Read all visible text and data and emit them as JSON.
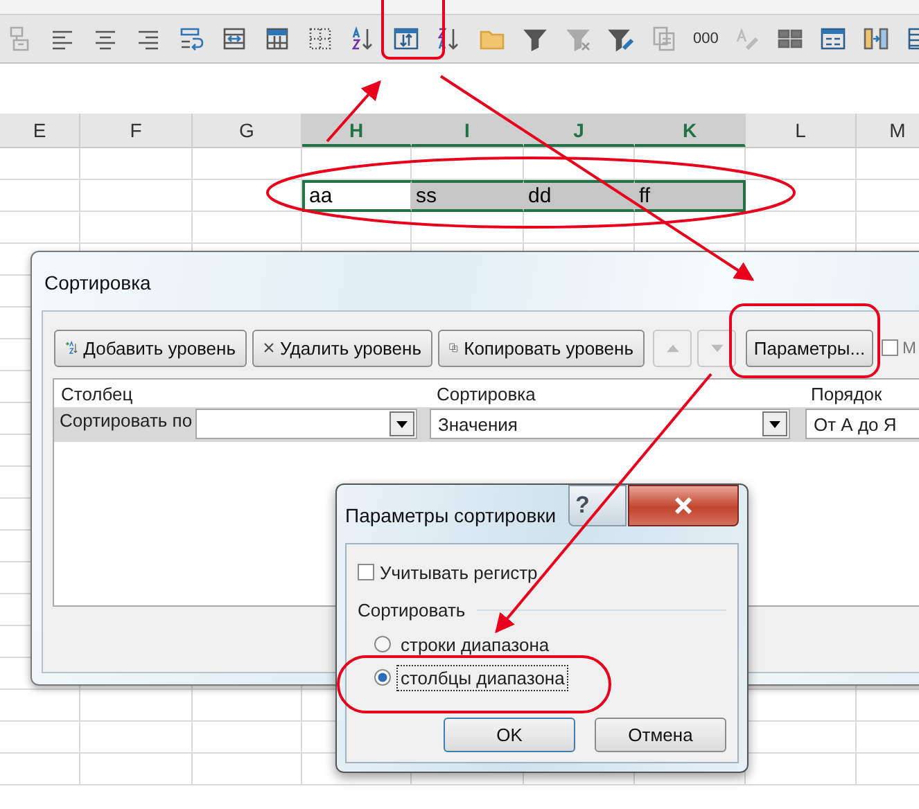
{
  "toolbar": {
    "number_format_label": "000"
  },
  "columns": [
    {
      "label": "E",
      "selected": false
    },
    {
      "label": "F",
      "selected": false
    },
    {
      "label": "G",
      "selected": false
    },
    {
      "label": "H",
      "selected": true
    },
    {
      "label": "I",
      "selected": true
    },
    {
      "label": "J",
      "selected": true
    },
    {
      "label": "K",
      "selected": true
    },
    {
      "label": "L",
      "selected": false
    },
    {
      "label": "M",
      "selected": false
    }
  ],
  "data_row": {
    "cells": [
      {
        "text": "aa",
        "selected": true,
        "active": true
      },
      {
        "text": "ss",
        "selected": true,
        "active": false
      },
      {
        "text": "dd",
        "selected": true,
        "active": false
      },
      {
        "text": "ff",
        "selected": true,
        "active": false
      }
    ]
  },
  "sort_dialog": {
    "title": "Сортировка",
    "buttons": [
      {
        "kind": "add",
        "label": "Добавить уровень",
        "disabled": false
      },
      {
        "kind": "delete",
        "label": "Удалить уровень",
        "disabled": false
      },
      {
        "kind": "copy",
        "label": "Копировать уровень",
        "disabled": false
      },
      {
        "kind": "up",
        "disabled": true
      },
      {
        "kind": "down",
        "disabled": true
      },
      {
        "kind": "text",
        "label": "Параметры...",
        "disabled": false
      }
    ],
    "header_checkbox": {
      "label": "М",
      "checked": false
    },
    "headers": [
      "Столбец",
      "Сортировка",
      "Порядок"
    ],
    "row": {
      "label": "Сортировать по",
      "sort_on": "Значения",
      "order": "От А до Я"
    }
  },
  "options_dialog": {
    "title": "Параметры сортировки",
    "help": "?",
    "case_checkbox": {
      "label": "Учитывать регистр",
      "checked": false
    },
    "group_label": "Сортировать",
    "options": [
      {
        "label": "строки диапазона",
        "selected": false
      },
      {
        "label": "столбцы диапазона",
        "selected": true
      }
    ],
    "buttons": [
      "OK",
      "Отмена"
    ]
  }
}
